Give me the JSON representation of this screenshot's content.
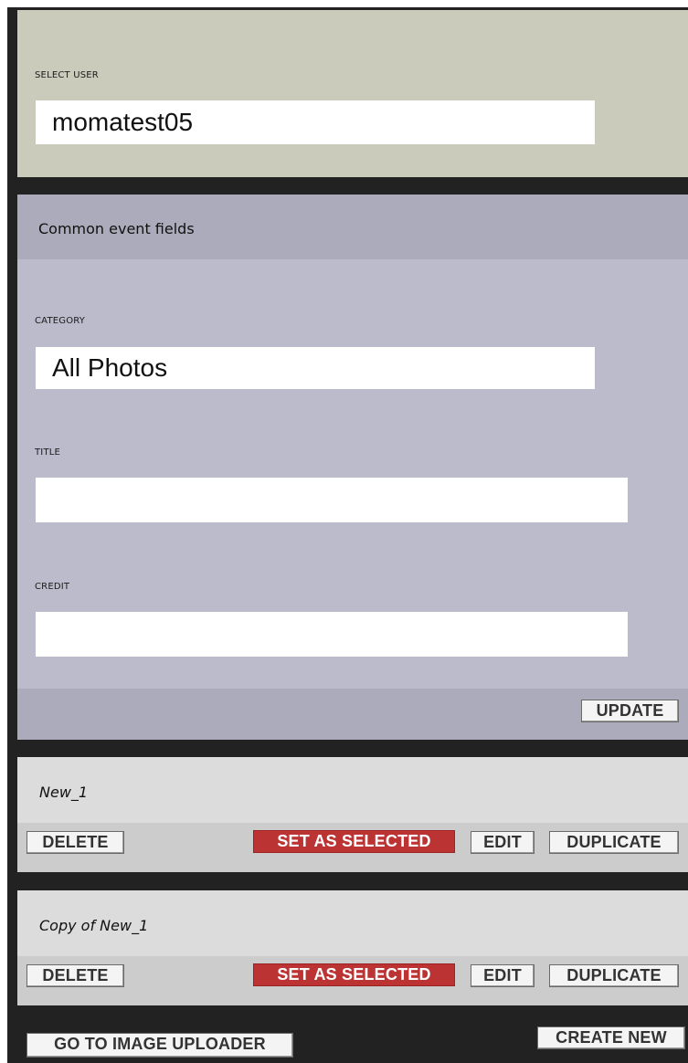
{
  "select_user": {
    "label": "SELECT USER",
    "value": "momatest05"
  },
  "common_fields": {
    "title": "Common event fields",
    "category_label": "CATEGORY",
    "category_value": "All Photos",
    "title_label": "TITLE",
    "title_value": "",
    "credit_label": "CREDIT",
    "credit_value": "",
    "update_label": "UPDATE"
  },
  "events": [
    {
      "name": "New_1",
      "delete_label": "DELETE",
      "set_selected_label": "SET AS SELECTED",
      "edit_label": "EDIT",
      "duplicate_label": "DUPLICATE"
    },
    {
      "name": "Copy of New_1",
      "delete_label": "DELETE",
      "set_selected_label": "SET AS SELECTED",
      "edit_label": "EDIT",
      "duplicate_label": "DUPLICATE"
    }
  ],
  "footer": {
    "image_uploader_label": "GO TO IMAGE UPLOADER",
    "create_new_label": "CREATE NEW"
  },
  "colors": {
    "frame": "#222222",
    "user_panel": "#cbcbbb",
    "common_panel": "#bbbbcb",
    "common_header": "#ababbb",
    "event_panel": "#dcdcdc",
    "event_actions": "#cccccc",
    "accent_red": "#bb3333"
  }
}
